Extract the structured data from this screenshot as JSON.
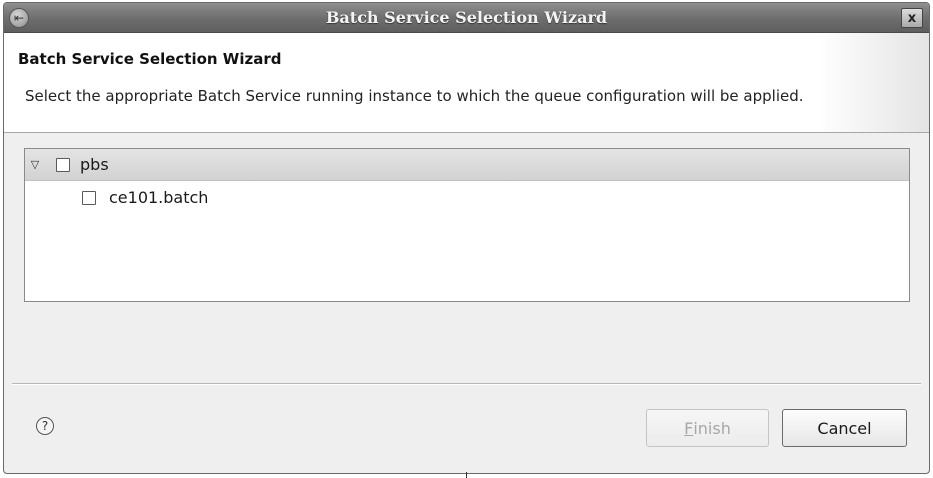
{
  "window": {
    "title": "Batch Service Selection Wizard",
    "menu_icon": "window-menu-icon",
    "close_icon": "close-icon",
    "close_glyph": "x"
  },
  "banner": {
    "title": "Batch Service Selection Wizard",
    "description": "Select the appropriate Batch Service running instance to which the queue configuration will be applied."
  },
  "tree": {
    "items": [
      {
        "label": "pbs",
        "expanded": true,
        "checked": false,
        "selected": true
      },
      {
        "label": "ce101.batch",
        "checked": false,
        "selected": false
      }
    ]
  },
  "footer": {
    "help_glyph": "?",
    "finish_mnemonic": "F",
    "finish_rest": "inish",
    "finish_enabled": false,
    "cancel_label": "Cancel"
  }
}
